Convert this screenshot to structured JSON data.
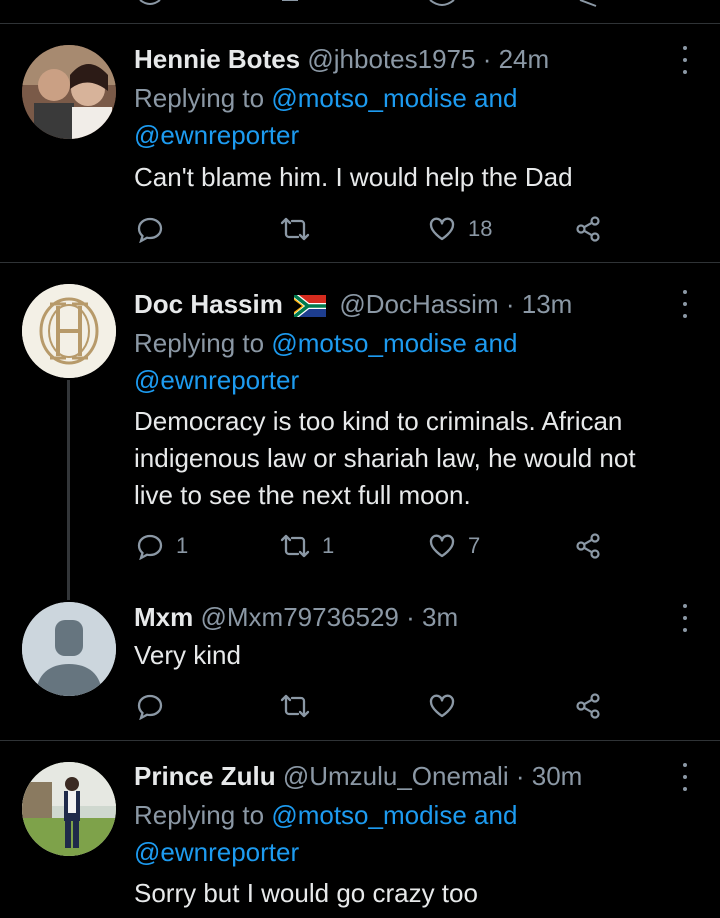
{
  "theme": {
    "background": "#000000",
    "text": "#e7e9ea",
    "secondary": "#8b98a5",
    "link": "#1d9bf0",
    "divider": "#2f3336"
  },
  "tweets": [
    {
      "name": "Hennie Botes",
      "handle": "@jhbotes1975",
      "time": "· 24m",
      "replying_prefix": "Replying to",
      "replying_to_1": "@motso_modise",
      "replying_and": "and",
      "replying_to_2": "@ewnreporter",
      "text": "Can't blame him. I would help the Dad",
      "replies": "",
      "retweets": "",
      "likes": "18",
      "icons": [
        "reply-icon",
        "retweet-icon",
        "like-icon",
        "share-icon",
        "more-icon"
      ]
    },
    {
      "name": "Doc Hassim",
      "flag": "south-africa-flag-icon",
      "handle": "@DocHassim",
      "time": "· 13m",
      "replying_prefix": "Replying to",
      "replying_to_1": "@motso_modise",
      "replying_and": "and",
      "replying_to_2": "@ewnreporter",
      "text_lines": [
        "Democracy is too kind to criminals. African",
        "indigenous law or shariah law, he would not",
        "live to see the next full moon."
      ],
      "replies": "1",
      "retweets": "1",
      "likes": "7"
    },
    {
      "name": "Mxm",
      "handle": "@Mxm79736529",
      "time": "· 3m",
      "text": "Very kind",
      "replies": "",
      "retweets": "",
      "likes": ""
    },
    {
      "name": "Prince Zulu",
      "handle": "@Umzulu_Onemali",
      "time": "· 30m",
      "replying_prefix": "Replying to",
      "replying_to_1": "@motso_modise",
      "replying_and": "and",
      "replying_to_2": "@ewnreporter",
      "text": "Sorry but I would go crazy too"
    }
  ]
}
